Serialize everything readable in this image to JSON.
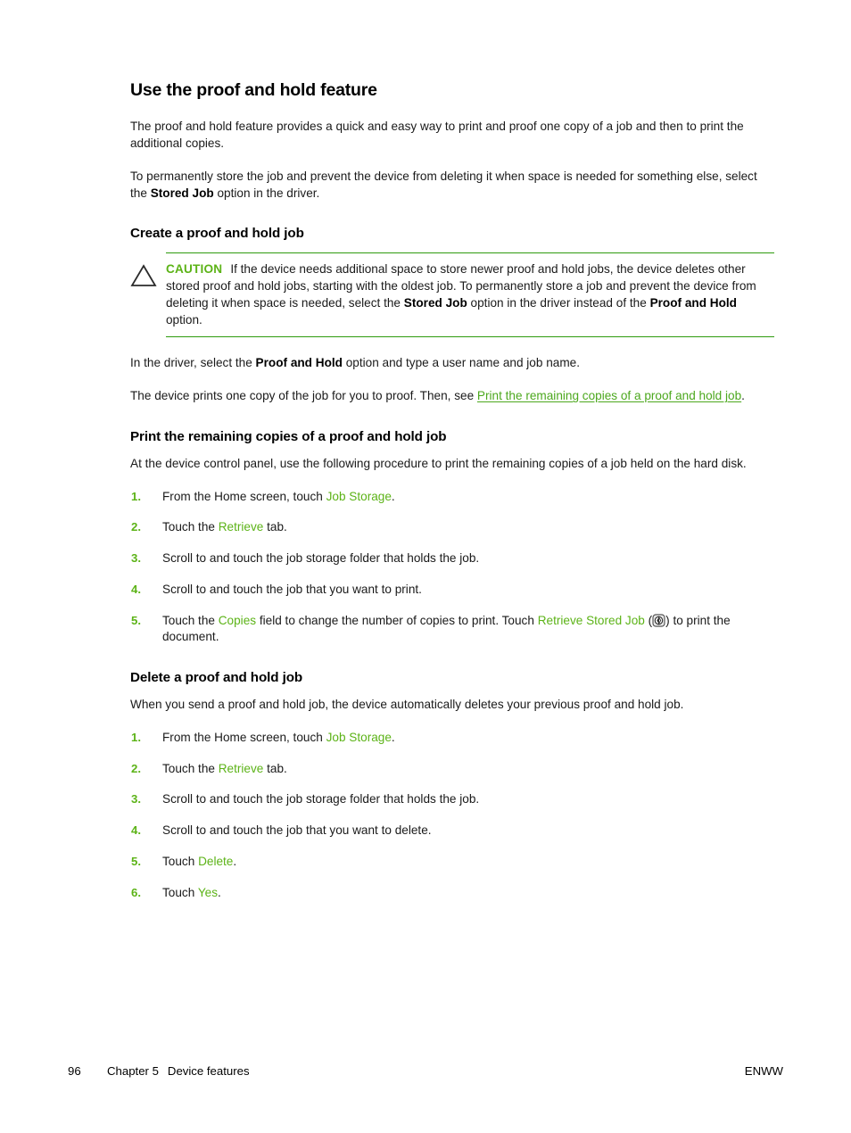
{
  "colors": {
    "accent_green": "#5CB317",
    "link_green": "#4CA81E",
    "rule_green": "#2E9B0E",
    "body_text": "#1a1a1a",
    "page_background": "#ffffff"
  },
  "page": {
    "title": "Use the proof and hold feature",
    "intro_paragraph_1": "The proof and hold feature provides a quick and easy way to print and proof one copy of a job and then to print the additional copies.",
    "intro_paragraph_2_before": "To permanently store the job and prevent the device from deleting it when space is needed for something else, select the ",
    "intro_paragraph_2_bold": "Stored Job",
    "intro_paragraph_2_after": " option in the driver."
  },
  "create_section": {
    "heading": "Create a proof and hold job",
    "caution": {
      "icon": "caution-triangle-icon",
      "label": "CAUTION",
      "text_1": "If the device needs additional space to store newer proof and hold jobs, the device deletes other stored proof and hold jobs, starting with the oldest job. To permanently store a job and prevent the device from deleting it when space is needed, select the ",
      "bold_1": "Stored Job",
      "text_2": " option in the driver instead of the ",
      "bold_2": "Proof and Hold",
      "text_3": " option."
    },
    "paragraph_driver_before": "In the driver, select the ",
    "paragraph_driver_bold": "Proof and Hold",
    "paragraph_driver_after": " option and type a user name and job name.",
    "paragraph_proof_before": "The device prints one copy of the job for you to proof. Then, see ",
    "paragraph_proof_link": "Print the remaining copies of a proof and hold job",
    "paragraph_proof_after": "."
  },
  "print_section": {
    "heading": "Print the remaining copies of a proof and hold job",
    "intro": "At the device control panel, use the following procedure to print the remaining copies of a job held on the hard disk.",
    "steps": [
      {
        "num": "1.",
        "before": "From the Home screen, touch ",
        "ui_term": "Job Storage",
        "after": "."
      },
      {
        "num": "2.",
        "before": "Touch the ",
        "ui_term": "Retrieve",
        "after": " tab."
      },
      {
        "num": "3.",
        "before": "Scroll to and touch the job storage folder that holds the job.",
        "ui_term": "",
        "after": ""
      },
      {
        "num": "4.",
        "before": "Scroll to and touch the job that you want to print.",
        "ui_term": "",
        "after": ""
      },
      {
        "num": "5.",
        "before": "Touch the ",
        "ui_term": "Copies",
        "mid": " field to change the number of copies to print. Touch ",
        "ui_term_2": "Retrieve Stored Job",
        "paren_open": " (",
        "icon": "start-button-icon",
        "paren_close": ") to",
        "after": " print the document."
      }
    ]
  },
  "delete_section": {
    "heading": "Delete a proof and hold job",
    "intro": "When you send a proof and hold job, the device automatically deletes your previous proof and hold job.",
    "steps": [
      {
        "num": "1.",
        "before": "From the Home screen, touch ",
        "ui_term": "Job Storage",
        "after": "."
      },
      {
        "num": "2.",
        "before": "Touch the ",
        "ui_term": "Retrieve",
        "after": " tab."
      },
      {
        "num": "3.",
        "before": "Scroll to and touch the job storage folder that holds the job.",
        "ui_term": "",
        "after": ""
      },
      {
        "num": "4.",
        "before": "Scroll to and touch the job that you want to delete.",
        "ui_term": "",
        "after": ""
      },
      {
        "num": "5.",
        "before": "Touch ",
        "ui_term": "Delete",
        "after": "."
      },
      {
        "num": "6.",
        "before": "Touch ",
        "ui_term": "Yes",
        "after": "."
      }
    ]
  },
  "footer": {
    "page_number": "96",
    "chapter_label": "Chapter 5",
    "chapter_title": "Device features",
    "locale": "ENWW"
  }
}
